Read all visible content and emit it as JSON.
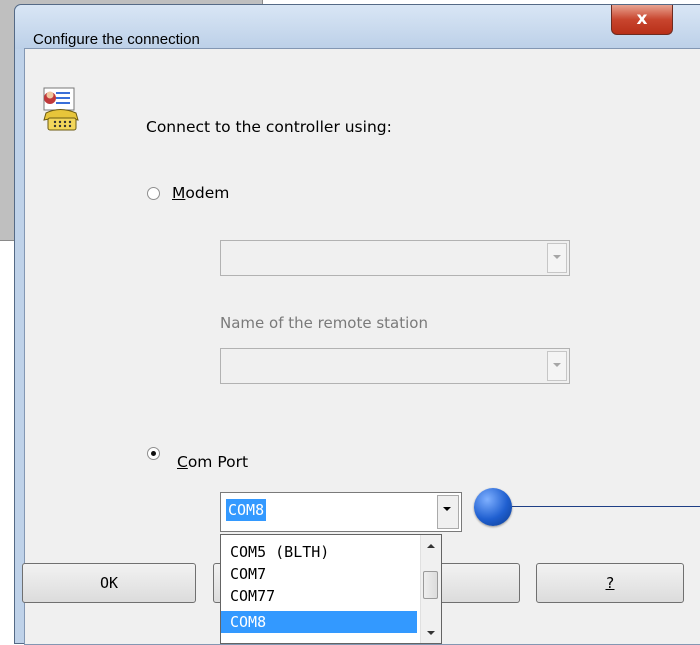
{
  "window": {
    "title": "Configure the connection",
    "close_glyph": "x"
  },
  "intro": {
    "text": "Connect to the controller using:",
    "icon": "phone-icon"
  },
  "modem": {
    "label_accel": "M",
    "label_rest": "odem",
    "selected": false,
    "device_value": "",
    "remote_station_label": "Name of the remote station",
    "remote_station_value": ""
  },
  "com_port": {
    "label_accel": "C",
    "label_rest": "om Port",
    "selected": true,
    "value": "COM8",
    "options": [
      "COM5 (BLTH)",
      "COM7",
      "COM77",
      "COM8"
    ],
    "highlighted": "COM8"
  },
  "buttons": {
    "ok": "OK",
    "help": "?"
  },
  "colors": {
    "selection": "#3399ff",
    "callout": "#1f5fd0"
  }
}
